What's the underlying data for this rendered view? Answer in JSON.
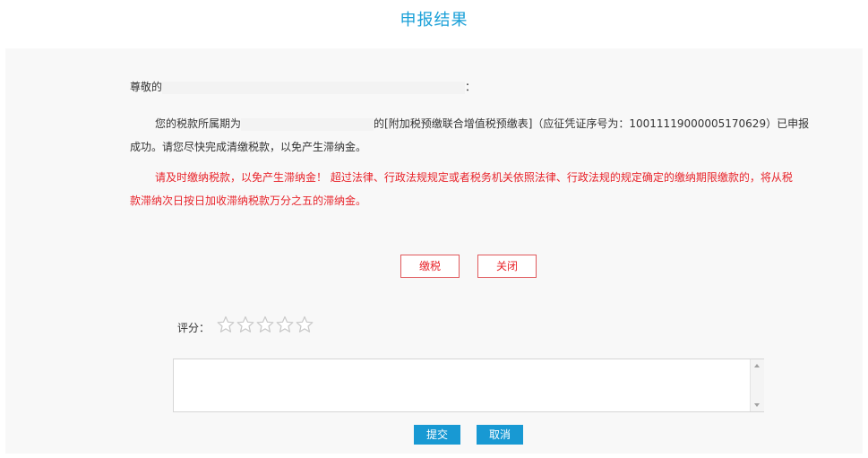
{
  "page_title": "申报结果",
  "greeting": {
    "prefix": "尊敬的",
    "suffix": "："
  },
  "message": {
    "line1_prefix": "您的税款所属期为",
    "line1_mid": "的[附加税预缴联合增值税预缴表]（应征凭证序号为：10011119000005170629）已申报",
    "line2": "成功。请您尽快完成清缴税款，以免产生滞纳金。"
  },
  "warning": {
    "line1": "请及时缴纳税款，以免产生滞纳金！ 超过法律、行政法规规定或者税务机关依照法律、行政法规的规定确定的缴纳期限缴款的，将从税",
    "line2": "款滞纳次日按日加收滞纳税款万分之五的滞纳金。"
  },
  "actions": {
    "pay_label": "缴税",
    "close_label": "关闭"
  },
  "rating": {
    "label": "评分：",
    "value": 0,
    "max": 5,
    "star_outline_color": "#c8c8c8"
  },
  "feedback": {
    "comment_value": "",
    "submit_label": "提交",
    "cancel_label": "取消"
  },
  "colors": {
    "title": "#1aa0d8",
    "warning": "#e8242b",
    "primary_button": "#1899d3",
    "outline_button_border": "#e0595c"
  }
}
